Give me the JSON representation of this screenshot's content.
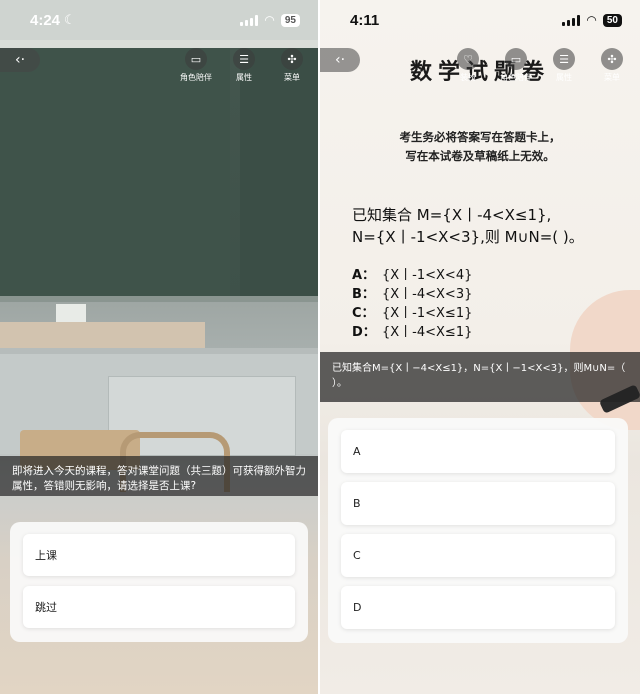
{
  "left_screen": {
    "status": {
      "time": "4:24",
      "battery": "95"
    },
    "top_menu": [
      {
        "label": "角色陪伴",
        "icon": "chat-icon"
      },
      {
        "label": "属性",
        "icon": "profile-icon"
      },
      {
        "label": "菜单",
        "icon": "menu-icon"
      }
    ],
    "dialog_text": "即将进入今天的课程，答对课堂问题（共三题）可获得额外智力属性，答错则无影响，请选择是否上课?",
    "options": [
      "上课",
      "跳过"
    ]
  },
  "right_screen": {
    "status": {
      "time": "4:11",
      "battery": "50"
    },
    "top_menu": [
      {
        "label": "装扮",
        "icon": "dress-icon"
      },
      {
        "label": "角色陪伴",
        "icon": "chat-icon"
      },
      {
        "label": "属性",
        "icon": "profile-icon"
      },
      {
        "label": "菜单",
        "icon": "menu-icon"
      }
    ],
    "paper_title": "数学试题卷",
    "notice_line1": "考生务必将答案写在答题卡上，",
    "notice_line2": "写在本试卷及草稿纸上无效。",
    "question_line1": "已知集合 M={X丨-4<X≤1},",
    "question_line2": "N={X丨-1<X<3},则 M∪N=( )。",
    "choices": [
      {
        "letter": "A：",
        "text": "{X丨-1<X<4}"
      },
      {
        "letter": "B：",
        "text": "{X丨-4<X<3}"
      },
      {
        "letter": "C：",
        "text": "{X丨-1<X≤1}"
      },
      {
        "letter": "D：",
        "text": "{X丨-4<X≤1}"
      }
    ],
    "question_bar": "已知集合M={X丨−4<X≤1}，N={X丨−1<X<3}，则M∪N=（ ）。",
    "answers": [
      "A",
      "B",
      "C",
      "D"
    ]
  }
}
